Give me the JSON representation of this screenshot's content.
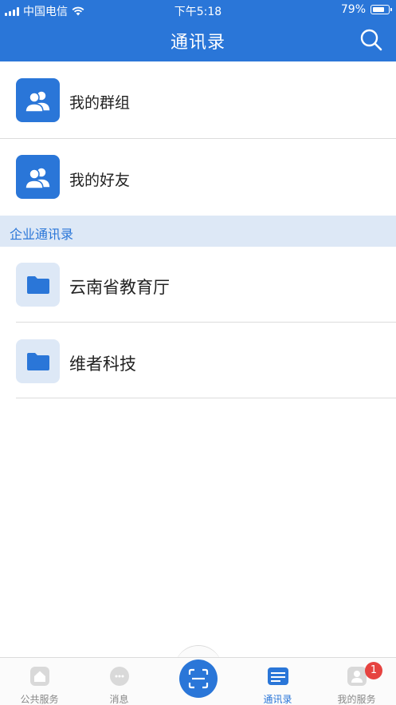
{
  "status_bar": {
    "carrier": "中国电信",
    "time": "下午5:18",
    "battery": "79%",
    "battery_level": 0.79
  },
  "header": {
    "title": "通讯录",
    "search_icon": "search-icon"
  },
  "groups": [
    {
      "label": "我的群组",
      "icon": "users-icon"
    },
    {
      "label": "我的好友",
      "icon": "users-icon"
    }
  ],
  "section": {
    "title": "企业通讯录"
  },
  "orgs": [
    {
      "label": "云南省教育厅",
      "icon": "folder-icon"
    },
    {
      "label": "维者科技",
      "icon": "folder-icon"
    }
  ],
  "tabbar": {
    "tabs": [
      {
        "label": "公共服务",
        "icon": "home-icon",
        "active": false
      },
      {
        "label": "消息",
        "icon": "chat-icon",
        "active": false
      },
      {
        "label": "",
        "icon": "scan-icon",
        "active": false
      },
      {
        "label": "通讯录",
        "icon": "contacts-icon",
        "active": true
      },
      {
        "label": "我的服务",
        "icon": "services-icon",
        "active": false,
        "badge": "1"
      }
    ]
  },
  "colors": {
    "primary": "#2a76d8",
    "section_bg": "#dde8f6",
    "badge": "#e64340"
  }
}
